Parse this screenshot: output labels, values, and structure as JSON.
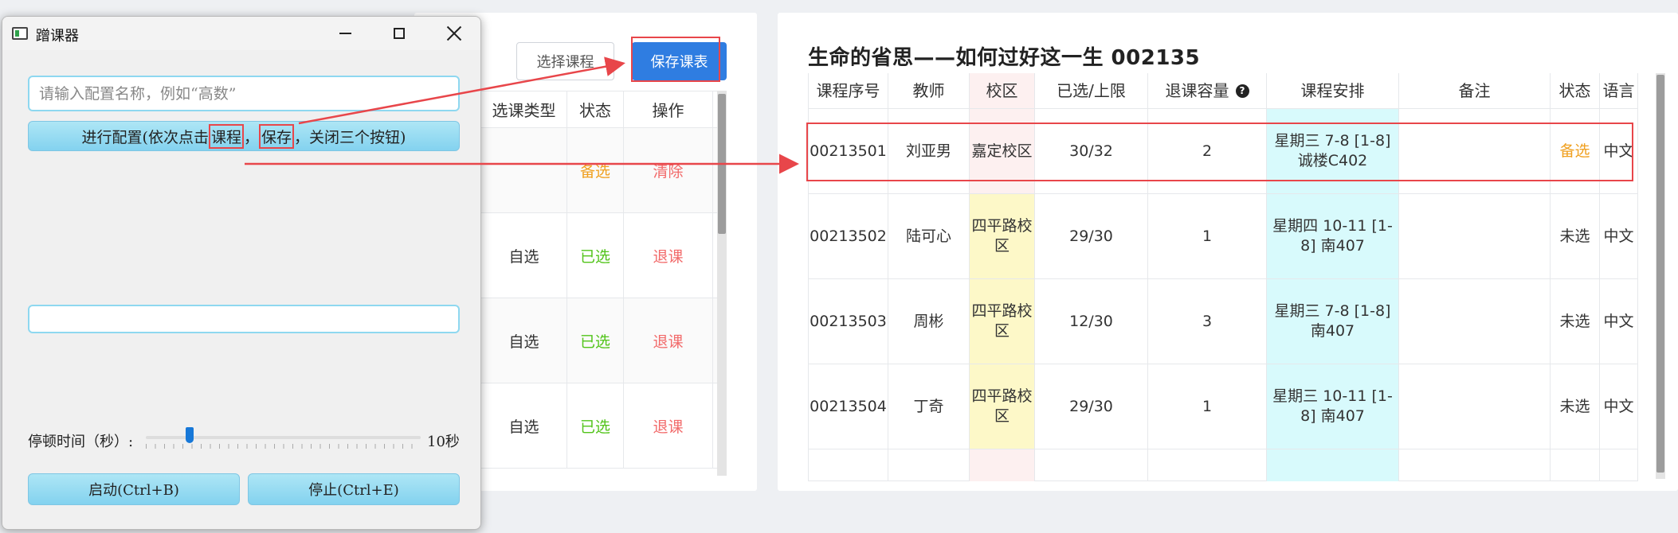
{
  "middle": {
    "choose_label": "选择课程",
    "save_label": "保存课表",
    "headers": [
      "选课类型",
      "状态",
      "操作"
    ],
    "rows": [
      {
        "type": "",
        "status": "备选",
        "action": "清除"
      },
      {
        "type": "自选",
        "status": "已选",
        "action": "退课"
      },
      {
        "type": "自选",
        "status": "已选",
        "action": "退课"
      },
      {
        "type": "自选",
        "status": "已选",
        "action": "退课"
      }
    ]
  },
  "right": {
    "course_title": "生命的省思——如何过好这一生 002135",
    "headers": [
      "课程序号",
      "教师",
      "校区",
      "已选/上限",
      "退课容量",
      "课程安排",
      "备注",
      "状态",
      "语言"
    ],
    "help_icon": "?",
    "rows": [
      {
        "id": "00213501",
        "teacher": "刘亚男",
        "campus": "嘉定校区",
        "count": "30/32",
        "drop": "2",
        "schedule": "星期三 7-8 [1-8] 诚楼C402",
        "note": "",
        "status": "备选",
        "lang": "中文"
      },
      {
        "id": "00213502",
        "teacher": "陆可心",
        "campus": "四平路校区",
        "count": "29/30",
        "drop": "1",
        "schedule": "星期四 10-11 [1-8] 南407",
        "note": "",
        "status": "未选",
        "lang": "中文"
      },
      {
        "id": "00213503",
        "teacher": "周彬",
        "campus": "四平路校区",
        "count": "12/30",
        "drop": "3",
        "schedule": "星期三 7-8 [1-8] 南407",
        "note": "",
        "status": "未选",
        "lang": "中文"
      },
      {
        "id": "00213504",
        "teacher": "丁奇",
        "campus": "四平路校区",
        "count": "29/30",
        "drop": "1",
        "schedule": "星期三 10-11 [1-8] 南407",
        "note": "",
        "status": "未选",
        "lang": "中文"
      }
    ]
  },
  "window": {
    "title": "蹭课器",
    "config_placeholder": "请输入配置名称，例如“高数”",
    "config_btn_prefix": "进行配置(依次点击",
    "config_btn_course": "课程",
    "config_btn_comma": "，",
    "config_btn_save": "保存",
    "config_btn_suffix": "，关闭三个按钮)",
    "pause_label": "停顿时间（秒）:",
    "pause_value": "10秒",
    "slider_fraction": 0.16,
    "start_label": "启动(Ctrl+B)",
    "stop_label": "停止(Ctrl+E)"
  },
  "colors": {
    "accent_blue": "#2f7de1",
    "annotation_red": "#e8464a",
    "status_orange": "#f0a020",
    "status_green": "#52c41a",
    "action_red": "#f26a6a"
  }
}
